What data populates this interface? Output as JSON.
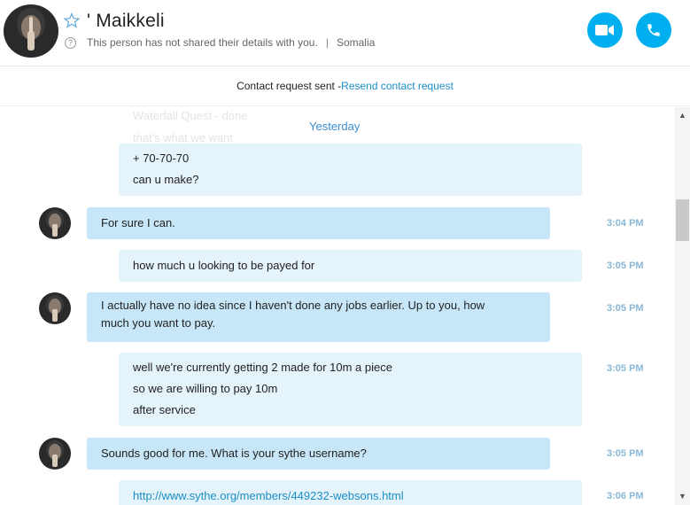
{
  "contact": {
    "name": "' Maikkeli",
    "details": "This person has not shared their details with you.",
    "location": "Somalia"
  },
  "request": {
    "status": "Contact request sent - ",
    "action": "Resend contact request"
  },
  "chat": {
    "faded_line_1": "Waterfall Quest - done",
    "faded_line_2": "that's what we want",
    "day_label": "Yesterday",
    "messages": [
      {
        "lines": [
          "+ 70-70-70",
          "can u make?"
        ],
        "time": ""
      },
      {
        "lines": [
          "For sure I can."
        ],
        "time": "3:04 PM"
      },
      {
        "lines": [
          "how much u looking to be payed for"
        ],
        "time": "3:05 PM"
      },
      {
        "lines": [
          "I actually have no idea since I haven't done any jobs earlier. Up to you, how",
          "much you want to pay."
        ],
        "time": "3:05 PM"
      },
      {
        "lines": [
          "well we're currently getting 2 made for 10m a piece",
          "so we are willing to pay 10m",
          "after service"
        ],
        "time": "3:05 PM"
      },
      {
        "lines": [
          "Sounds good for me. What is your sythe username?"
        ],
        "time": "3:05 PM"
      },
      {
        "lines": [
          "http://www.sythe.org/members/449232-websons.html"
        ],
        "time": "3:06 PM"
      }
    ]
  },
  "colors": {
    "accent": "#00aff0",
    "bubble_sent": "#e5f3fb",
    "bubble_received": "#c7e7f8",
    "link": "#1a8ec9"
  },
  "icons": {
    "favorite": "star-icon",
    "help": "help-icon",
    "video": "video-camera-icon",
    "audio": "phone-icon"
  }
}
